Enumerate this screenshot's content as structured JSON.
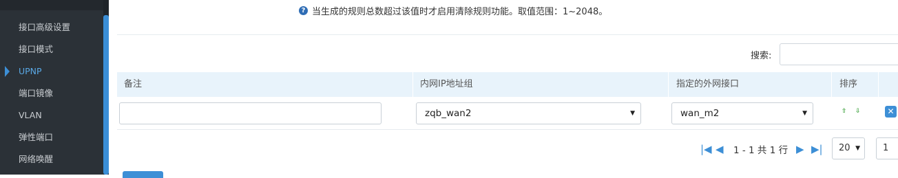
{
  "sidebar": {
    "items": [
      {
        "label": "接口高级设置"
      },
      {
        "label": "接口模式"
      },
      {
        "label": "UPNP"
      },
      {
        "label": "端口镜像"
      },
      {
        "label": "VLAN"
      },
      {
        "label": "弹性端口"
      },
      {
        "label": "网络唤醒"
      }
    ],
    "active_index": 2
  },
  "hint": {
    "icon": "question-circle-icon",
    "text": "当生成的规则总数超过该值时才启用清除规则功能。取值范围：1~2048。"
  },
  "search": {
    "label": "搜索:",
    "value": ""
  },
  "table": {
    "columns": [
      "备注",
      "内网IP地址组",
      "指定的外网接口",
      "排序"
    ],
    "rows": [
      {
        "note": "",
        "ip_group": "zqb_wan2",
        "wan_interface": "wan_m2"
      }
    ]
  },
  "pagination": {
    "summary": "1 - 1 共 1 行",
    "page_size": "20",
    "page": "1"
  },
  "colors": {
    "accent": "#3d8fd6",
    "sidebar_bg": "#2b3137",
    "header_bg": "#e8f3fb"
  }
}
